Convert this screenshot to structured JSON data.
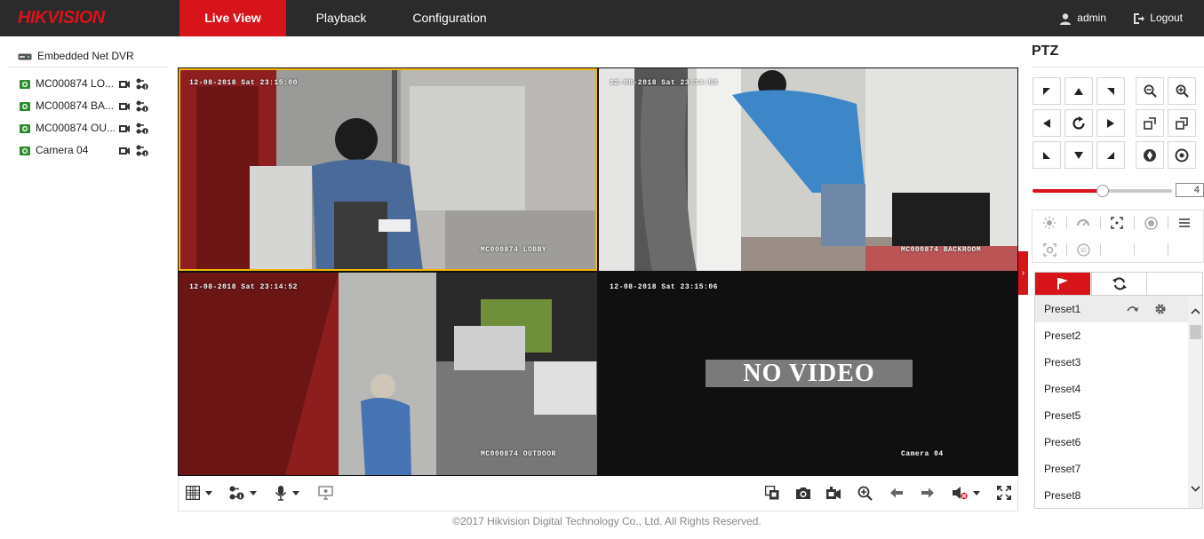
{
  "header": {
    "logo": "HIKVISION",
    "tabs": [
      {
        "label": "Live View",
        "active": true
      },
      {
        "label": "Playback",
        "active": false
      },
      {
        "label": "Configuration",
        "active": false
      }
    ],
    "user": "admin",
    "logout": "Logout"
  },
  "sidebar": {
    "device": "Embedded Net DVR",
    "cameras": [
      {
        "label": "MC000874 LO..."
      },
      {
        "label": "MC000874 BA..."
      },
      {
        "label": "MC000874 OU..."
      },
      {
        "label": "Camera 04"
      }
    ]
  },
  "video": {
    "tiles": [
      {
        "timestamp": "12-08-2018 Sat 23:15:00",
        "osd_name": "MC000874 LOBBY"
      },
      {
        "timestamp": "12-08-2018 Sat 23:14:53",
        "osd_name": "MC000874 BACKROOM"
      },
      {
        "timestamp": "12-08-2018 Sat 23:14:52",
        "osd_name": "MC000874 OUTDOOR"
      },
      {
        "timestamp": "12-08-2018 Sat 23:15:06",
        "osd_name": "Camera 04",
        "no_video": "NO VIDEO"
      }
    ]
  },
  "footer": "©2017 Hikvision Digital Technology Co., Ltd. All Rights Reserved.",
  "ptz": {
    "title": "PTZ",
    "speed": 4,
    "speed_max": 7,
    "presets": [
      "Preset1",
      "Preset2",
      "Preset3",
      "Preset4",
      "Preset5",
      "Preset6",
      "Preset7",
      "Preset8"
    ]
  },
  "colors": {
    "brand": "#d7141a",
    "topbar": "#2b2b2b",
    "selected_tile": "#f2b705"
  }
}
